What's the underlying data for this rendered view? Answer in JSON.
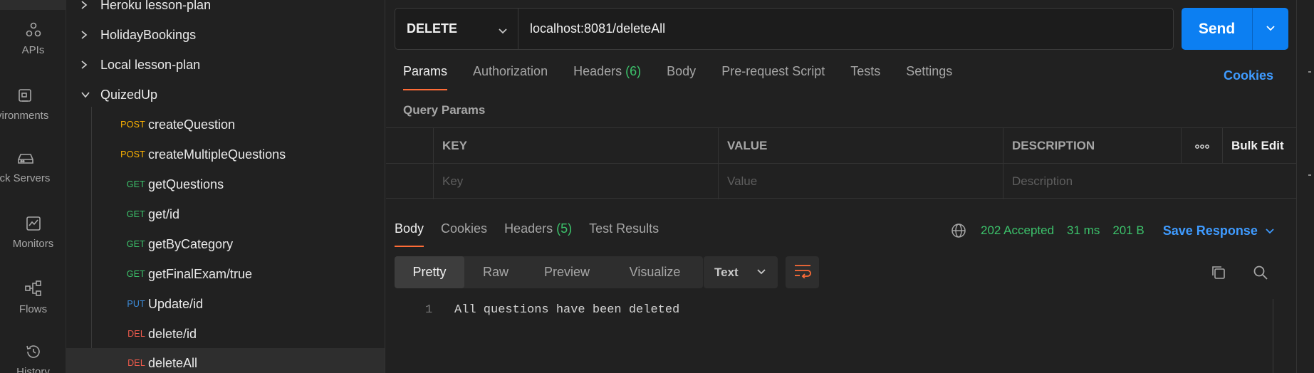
{
  "rail": {
    "items": [
      {
        "label": "APIs",
        "icon": "apis-icon"
      },
      {
        "label": "Environments",
        "icon": "environments-icon"
      },
      {
        "label": "Mock Servers",
        "icon": "mock-servers-icon"
      },
      {
        "label": "Monitors",
        "icon": "monitors-icon"
      },
      {
        "label": "Flows",
        "icon": "flows-icon"
      },
      {
        "label": "History",
        "icon": "history-icon"
      }
    ]
  },
  "tree": {
    "folders": [
      {
        "name": "Heroku lesson-plan"
      },
      {
        "name": "HolidayBookings"
      },
      {
        "name": "Local lesson-plan"
      },
      {
        "name": "QuizedUp"
      }
    ],
    "requests": [
      {
        "method": "POST",
        "name": "createQuestion"
      },
      {
        "method": "POST",
        "name": "createMultipleQuestions"
      },
      {
        "method": "GET",
        "name": "getQuestions"
      },
      {
        "method": "GET",
        "name": "get/id"
      },
      {
        "method": "GET",
        "name": "getByCategory"
      },
      {
        "method": "GET",
        "name": "getFinalExam/true"
      },
      {
        "method": "PUT",
        "name": "Update/id"
      },
      {
        "method": "DEL",
        "name": "delete/id"
      },
      {
        "method": "DEL",
        "name": "deleteAll"
      }
    ]
  },
  "request": {
    "method": "DELETE",
    "url": "localhost:8081/deleteAll",
    "send_label": "Send",
    "tabs": {
      "params": "Params",
      "authorization": "Authorization",
      "headers": "Headers",
      "headers_count": "(6)",
      "body": "Body",
      "prerequest": "Pre-request Script",
      "tests": "Tests",
      "settings": "Settings"
    },
    "cookies_link": "Cookies"
  },
  "query_params": {
    "title": "Query Params",
    "columns": {
      "key": "KEY",
      "value": "VALUE",
      "description": "DESCRIPTION",
      "more": "ooo",
      "bulk_edit": "Bulk Edit"
    },
    "placeholders": {
      "key": "Key",
      "value": "Value",
      "description": "Description"
    }
  },
  "response": {
    "tabs": {
      "body": "Body",
      "cookies": "Cookies",
      "headers": "Headers",
      "headers_count": "(5)",
      "test_results": "Test Results"
    },
    "status": "202 Accepted",
    "time": "31 ms",
    "size": "201 B",
    "save_label": "Save Response",
    "formats": {
      "pretty": "Pretty",
      "raw": "Raw",
      "preview": "Preview",
      "visualize": "Visualize"
    },
    "language": "Text",
    "lines": [
      {
        "no": "1",
        "text": "All questions have been deleted"
      }
    ]
  },
  "colors": {
    "accent": "#ff6c37",
    "send": "#0c7ff2",
    "link": "#3f9bff",
    "success": "#3cc26b",
    "post": "#ffb400",
    "get": "#3cc26b",
    "put": "#3d8ddb",
    "del": "#ef5b4c"
  }
}
